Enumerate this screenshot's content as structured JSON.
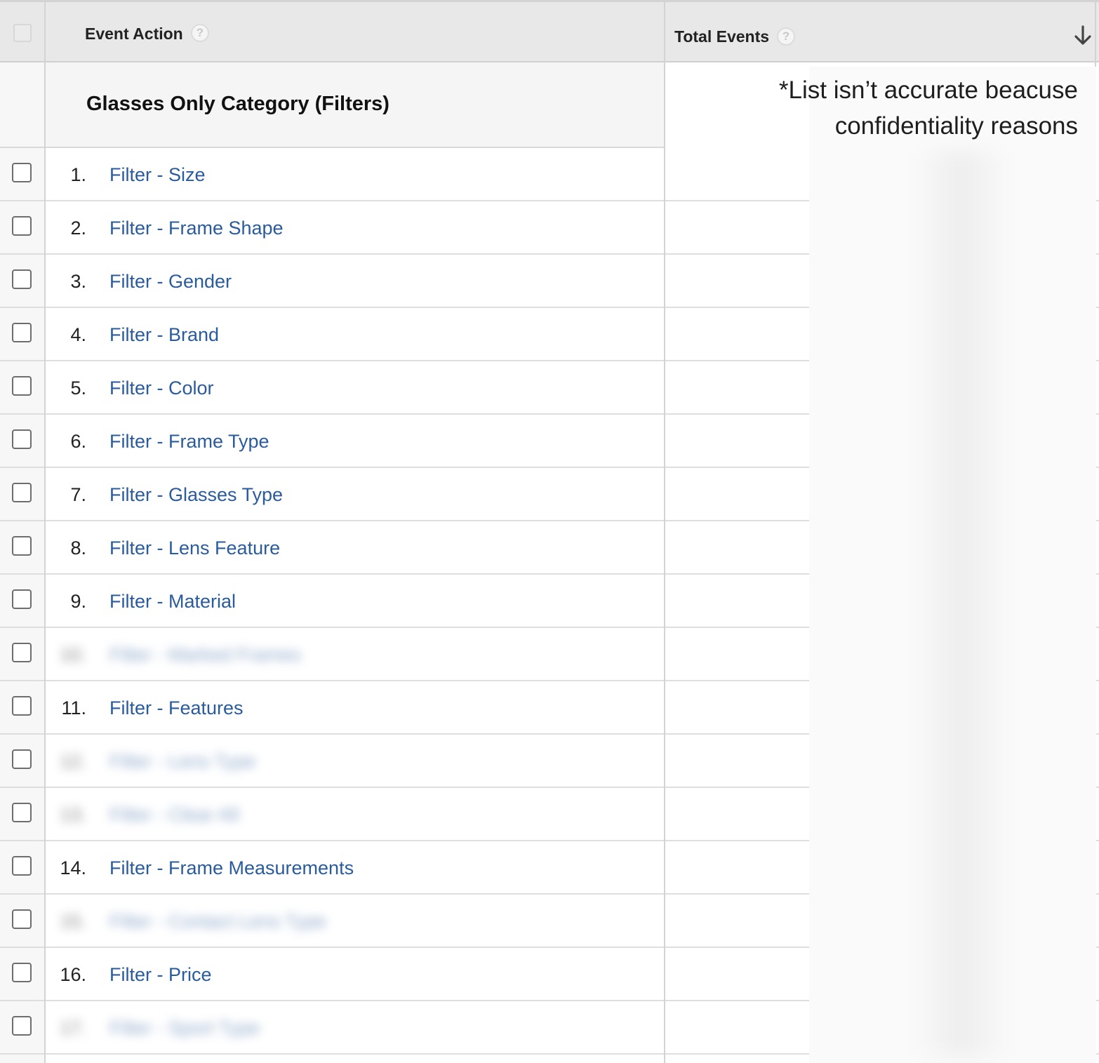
{
  "header": {
    "event_action_label": "Event Action",
    "total_events_label": "Total Events",
    "help_glyph": "?"
  },
  "group": {
    "title": "Glasses Only Category (Filters)"
  },
  "note": {
    "line1": "*List isn’t accurate beacuse",
    "line2": "confidentiality reasons"
  },
  "rows": [
    {
      "num": "1.",
      "label": "Filter - Size"
    },
    {
      "num": "2.",
      "label": "Filter - Frame Shape"
    },
    {
      "num": "3.",
      "label": "Filter - Gender"
    },
    {
      "num": "4.",
      "label": "Filter - Brand"
    },
    {
      "num": "5.",
      "label": "Filter - Color"
    },
    {
      "num": "6.",
      "label": "Filter - Frame Type"
    },
    {
      "num": "7.",
      "label": "Filter - Glasses Type"
    },
    {
      "num": "8.",
      "label": "Filter - Lens Feature"
    },
    {
      "num": "9.",
      "label": "Filter - Material"
    },
    {
      "num": "10.",
      "label": "Filter - Marked Frames"
    },
    {
      "num": "11.",
      "label": "Filter - Features"
    },
    {
      "num": "12.",
      "label": "Filter - Lens Type"
    },
    {
      "num": "13.",
      "label": "Filter - Clear All"
    },
    {
      "num": "14.",
      "label": "Filter - Frame Measurements"
    },
    {
      "num": "15.",
      "label": "Filter - Contact Lens Type"
    },
    {
      "num": "16.",
      "label": "Filter - Price"
    },
    {
      "num": "17.",
      "label": "Filter - Sport Type"
    }
  ],
  "colors": {
    "link": "#2a5b9c",
    "header_bg": "#e8e8e8"
  },
  "icons": {
    "help": "question-circle-icon",
    "sort": "arrow-down-icon"
  }
}
